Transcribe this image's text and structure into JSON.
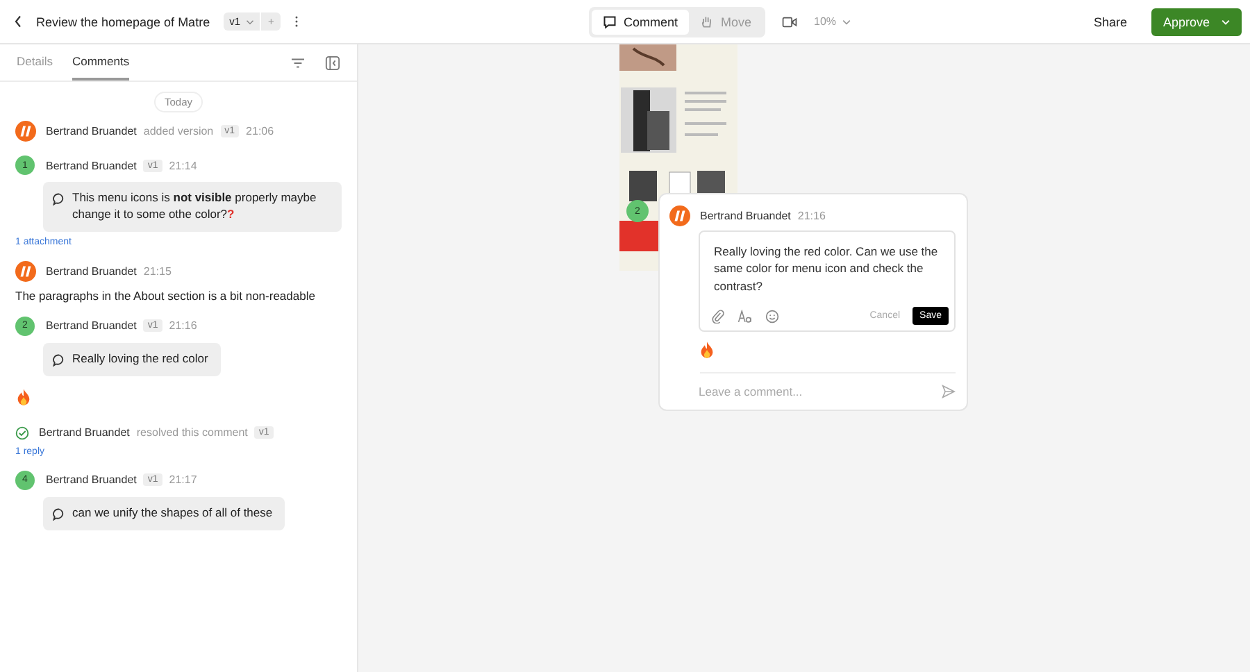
{
  "header": {
    "title": "Review the homepage of Matre",
    "version": "v1",
    "add": "+"
  },
  "toolbar": {
    "tools": [
      {
        "label": "Comment",
        "selected": true
      },
      {
        "label": "Move",
        "selected": false
      }
    ],
    "zoom": "10%",
    "share": "Share",
    "approve": "Approve"
  },
  "sidebar": {
    "tabs": [
      {
        "label": "Details",
        "selected": false
      },
      {
        "label": "Comments",
        "selected": true
      }
    ],
    "date": "Today",
    "feed": [
      {
        "kind": "event",
        "author": "Bertrand Bruandet",
        "action": "added version",
        "version": "v1",
        "time": "21:06"
      },
      {
        "kind": "comment",
        "pin": "1",
        "author": "Bertrand Bruandet",
        "version": "v1",
        "time": "21:14",
        "text": "This menu icons is **not visible** properly maybe change it to some othe color?",
        "mark": "?",
        "link": "1 attachment",
        "reaction": false
      },
      {
        "kind": "note",
        "author": "Bertrand Bruandet",
        "time": "21:15",
        "text": "The paragraphs in the About section is a bit non-readable"
      },
      {
        "kind": "comment",
        "pin": "2",
        "author": "Bertrand Bruandet",
        "version": "v1",
        "time": "21:16",
        "text": "Really loving the red color",
        "reaction": true
      },
      {
        "kind": "resolved",
        "author": "Bertrand Bruandet",
        "action": "resolved this comment",
        "version": "v1",
        "link": "1 reply"
      },
      {
        "kind": "comment",
        "pin": "4",
        "author": "Bertrand Bruandet",
        "version": "v1",
        "time": "21:17",
        "text": "can we unify the shapes of all of these",
        "reaction": false
      }
    ]
  },
  "canvas": {
    "pin": "2",
    "popup": {
      "author": "Bertrand Bruandet",
      "time": "21:16",
      "value": "Really loving the red color. Can we use the same color for menu icon and check the contrast?",
      "cancel": "Cancel",
      "save": "Save",
      "reaction": true,
      "placeholder": "Leave a comment..."
    }
  }
}
